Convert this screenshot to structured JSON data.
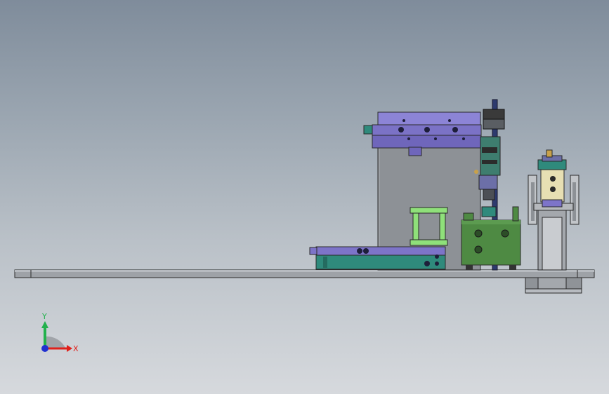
{
  "triad": {
    "x_label": "X",
    "y_label": "Y",
    "x_color": "#e0201a",
    "y_color": "#22b14c",
    "z_color": "#2030d0"
  },
  "colors": {
    "background_top": "#7f8c9b",
    "background_bottom": "#d6d9dd",
    "frame_gray": "#8f9398",
    "plate_gray": "#a4a8ad",
    "purple": "#7d74c9",
    "teal": "#2f8a7c",
    "green_block": "#4e8a43",
    "light_green": "#8fe07a",
    "navy_rod": "#2d3a6e"
  }
}
